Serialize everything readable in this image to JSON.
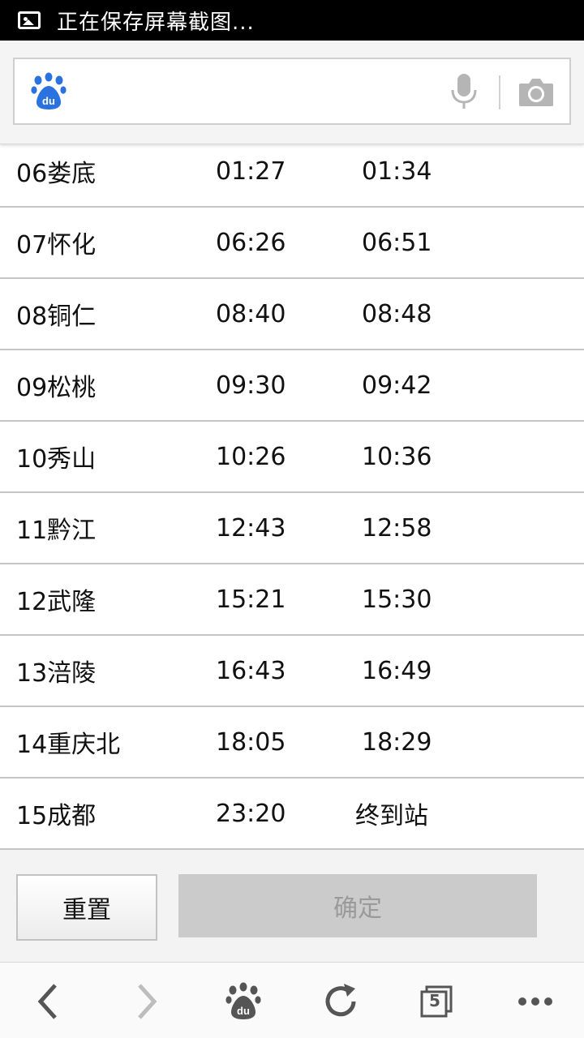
{
  "status_bar": {
    "notification_icon": "image-icon",
    "text": "正在保存屏幕截图..."
  },
  "search": {
    "logo": "baidu-paw-logo",
    "placeholder": "",
    "mic_icon": "microphone-icon",
    "camera_icon": "camera-icon"
  },
  "schedule": {
    "rows": [
      {
        "station": "06娄底",
        "arrive": "01:27",
        "depart": "01:34"
      },
      {
        "station": "07怀化",
        "arrive": "06:26",
        "depart": "06:51"
      },
      {
        "station": "08铜仁",
        "arrive": "08:40",
        "depart": "08:48"
      },
      {
        "station": "09松桃",
        "arrive": "09:30",
        "depart": "09:42"
      },
      {
        "station": "10秀山",
        "arrive": "10:26",
        "depart": "10:36"
      },
      {
        "station": "11黔江",
        "arrive": "12:43",
        "depart": "12:58"
      },
      {
        "station": "12武隆",
        "arrive": "15:21",
        "depart": "15:30"
      },
      {
        "station": "13涪陵",
        "arrive": "16:43",
        "depart": "16:49"
      },
      {
        "station": "14重庆北",
        "arrive": "18:05",
        "depart": "18:29"
      },
      {
        "station": "15成都",
        "arrive": "23:20",
        "depart": "终到站"
      }
    ]
  },
  "actions": {
    "reset_label": "重置",
    "confirm_label": "确定"
  },
  "bottom_nav": {
    "tab_count": "5",
    "icons": [
      "back-icon",
      "forward-icon",
      "baidu-home-icon",
      "refresh-icon",
      "tabs-icon",
      "more-icon"
    ]
  },
  "colors": {
    "baidu_blue": "#2a72e0",
    "icon_gray": "#555555",
    "disabled_gray": "#cbcbcb"
  }
}
